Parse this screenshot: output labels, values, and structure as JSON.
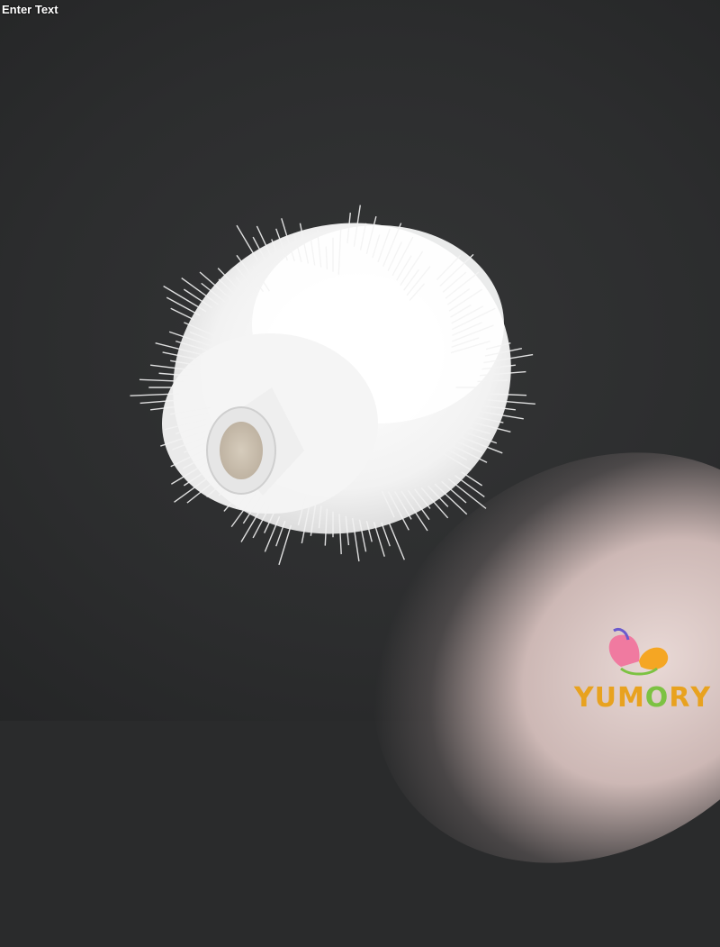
{
  "caption": "Enter Text",
  "logo": {
    "letters": [
      "Y",
      "U",
      "M",
      "O",
      "R",
      "Y"
    ],
    "colors": [
      "#e8a21f",
      "#e8a21f",
      "#e8a21f",
      "#7cc242",
      "#e8a21f",
      "#e8a21f"
    ]
  }
}
